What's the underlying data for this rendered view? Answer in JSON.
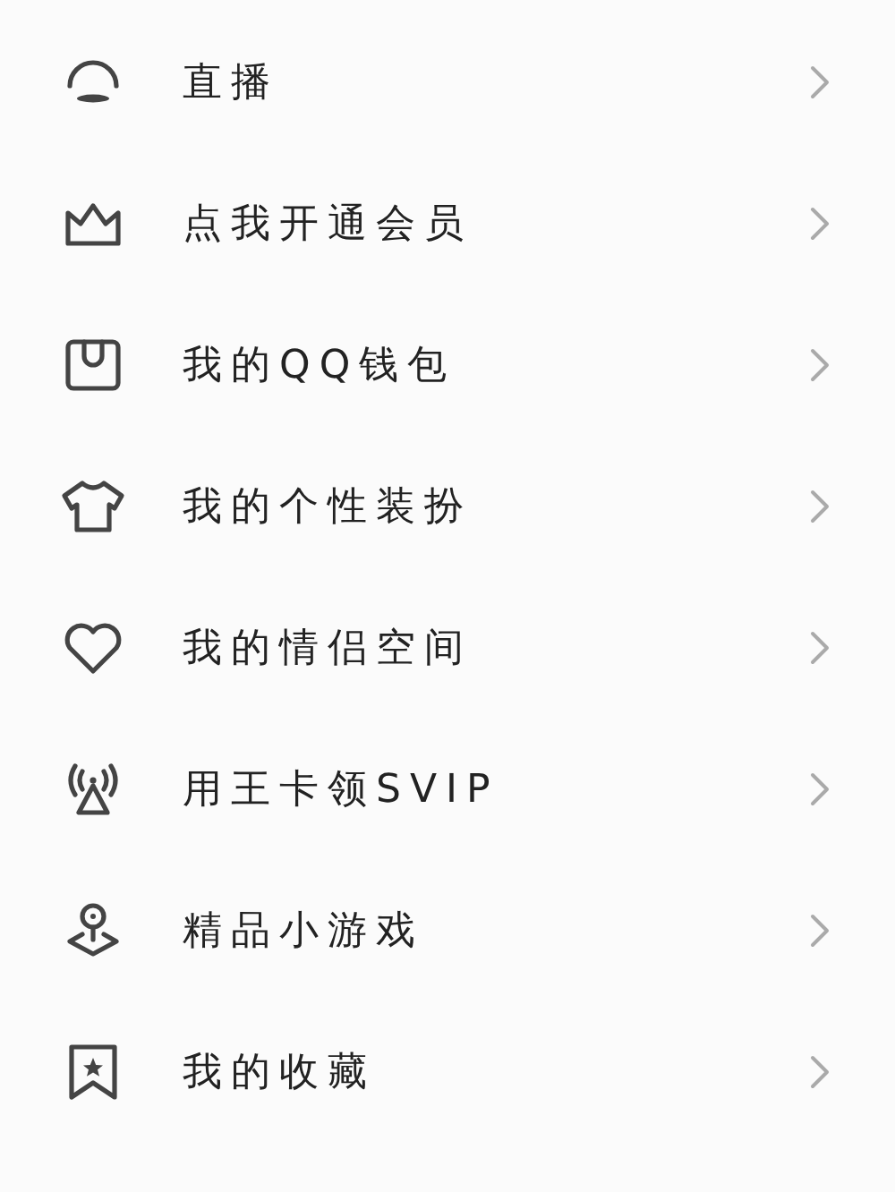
{
  "menu": [
    {
      "kind": "live",
      "label": "直播"
    },
    {
      "kind": "crown",
      "label": "点我开通会员"
    },
    {
      "kind": "wallet",
      "label": "我的QQ钱包"
    },
    {
      "kind": "shirt",
      "label": "我的个性装扮"
    },
    {
      "kind": "heart",
      "label": "我的情侣空间"
    },
    {
      "kind": "signal",
      "label": "用王卡领SVIP"
    },
    {
      "kind": "game",
      "label": "精品小游戏"
    },
    {
      "kind": "bookmark",
      "label": "我的收藏"
    }
  ]
}
